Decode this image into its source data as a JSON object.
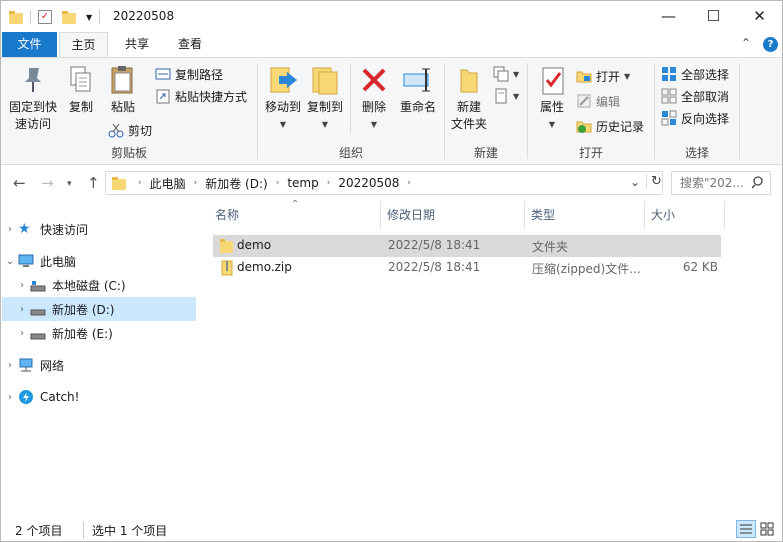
{
  "window": {
    "title": "20220508",
    "minimize": "—",
    "maximize": "☐",
    "close": "✕"
  },
  "tabs": {
    "file": "文件",
    "home": "主页",
    "share": "共享",
    "view": "查看",
    "collapse": "⌃",
    "help": "?"
  },
  "ribbon": {
    "clipboard": {
      "label": "剪贴板",
      "pin_line1": "固定到快",
      "pin_line2": "速访问",
      "copy": "复制",
      "paste": "粘贴",
      "copy_path": "复制路径",
      "paste_shortcut": "粘贴快捷方式",
      "cut": "剪切"
    },
    "organize": {
      "label": "组织",
      "move_to": "移动到",
      "copy_to": "复制到",
      "delete": "删除",
      "rename": "重命名"
    },
    "new": {
      "label": "新建",
      "new_folder_line1": "新建",
      "new_folder_line2": "文件夹"
    },
    "open": {
      "label": "打开",
      "properties": "属性",
      "open": "打开",
      "edit": "编辑",
      "history": "历史记录"
    },
    "select": {
      "label": "选择",
      "select_all": "全部选择",
      "select_none": "全部取消",
      "invert": "反向选择"
    }
  },
  "address": {
    "crumbs": [
      "此电脑",
      "新加卷 (D:)",
      "temp",
      "20220508"
    ],
    "search_placeholder": "搜索\"202..."
  },
  "nav": {
    "quick_access": "快速访问",
    "this_pc": "此电脑",
    "local_c": "本地磁盘 (C:)",
    "vol_d": "新加卷 (D:)",
    "vol_e": "新加卷 (E:)",
    "network": "网络",
    "catch": "Catch!"
  },
  "columns": {
    "name": "名称",
    "date": "修改日期",
    "type": "类型",
    "size": "大小"
  },
  "files": [
    {
      "name": "demo",
      "date": "2022/5/8 18:41",
      "type": "文件夹",
      "size": ""
    },
    {
      "name": "demo.zip",
      "date": "2022/5/8 18:41",
      "type": "压缩(zipped)文件...",
      "size": "62 KB"
    }
  ],
  "status": {
    "count": "2 个项目",
    "selected": "选中 1 个项目"
  },
  "colors": {
    "accent": "#1979ca",
    "selection": "#cce8ff",
    "folder": "#f8d775",
    "delete_red": "#d9292c"
  }
}
